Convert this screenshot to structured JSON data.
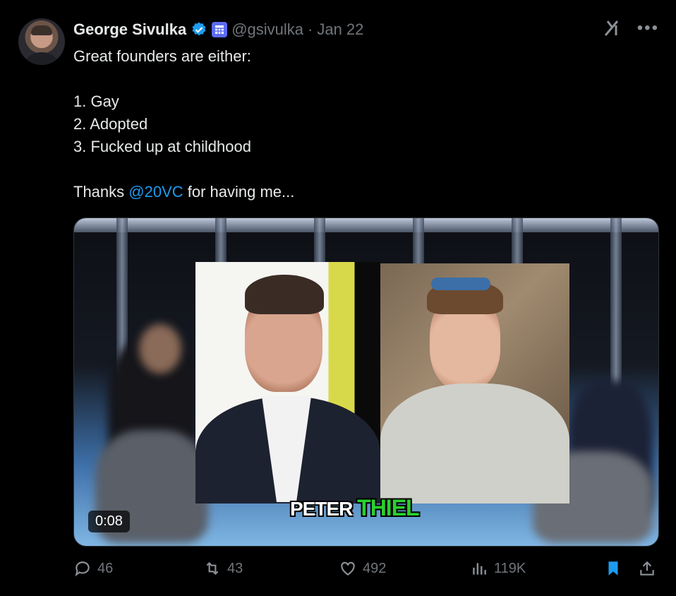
{
  "author": {
    "name": "George Sivulka",
    "handle": "@gsivulka",
    "separator": "·",
    "date": "Jan 22"
  },
  "tweet": {
    "line1": "Great founders are either:",
    "list": [
      "1. Gay",
      "2. Adopted",
      "3. Fucked up at childhood"
    ],
    "thanks_prefix": "Thanks ",
    "mention": "@20VC",
    "thanks_suffix": " for having me..."
  },
  "media": {
    "duration": "0:08",
    "caption_word1": "PETER",
    "caption_word2": "THIEL"
  },
  "actions": {
    "replies": "46",
    "reposts": "43",
    "likes": "492",
    "views": "119K"
  },
  "colors": {
    "background": "#000000",
    "text": "#e7e9ea",
    "muted": "#71767b",
    "accent": "#1d9bf0",
    "caption_green": "#2ad12e"
  },
  "icons": [
    "verified-badge-icon",
    "affiliate-badge-icon",
    "grok-icon",
    "more-icon",
    "reply-icon",
    "repost-icon",
    "like-icon",
    "views-icon",
    "bookmark-icon",
    "share-icon"
  ]
}
